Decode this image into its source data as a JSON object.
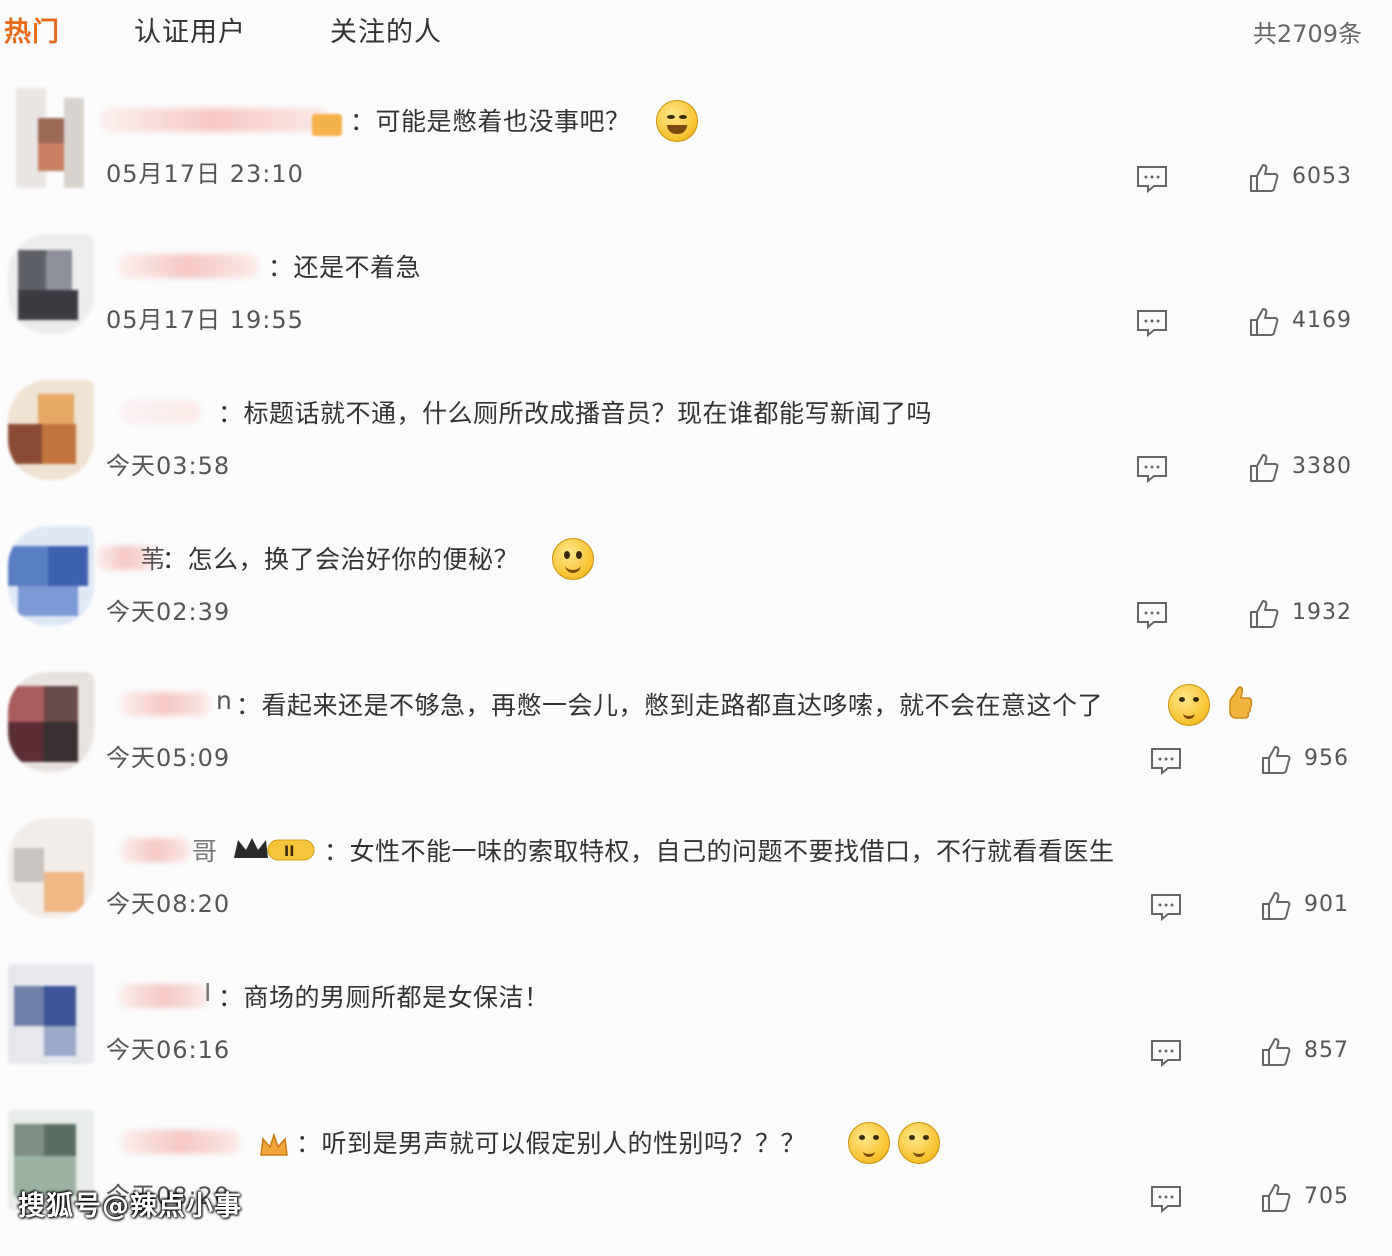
{
  "tabs": [
    {
      "label": "热门",
      "active": true
    },
    {
      "label": "认证用户",
      "active": false
    },
    {
      "label": "关注的人",
      "active": false
    }
  ],
  "total_count": "共2709条",
  "accent_color": "#e86a1a",
  "comments": [
    {
      "name_fragment": "",
      "text": "：可能是憋着也没事吧？",
      "time": "05月17日 23:10",
      "likes": "6053",
      "emojis": [
        "laugh-cry-emoji"
      ]
    },
    {
      "name_fragment": "",
      "text": "：还是不着急",
      "time": "05月17日 19:55",
      "likes": "4169",
      "emojis": []
    },
    {
      "name_fragment": "",
      "text": "：标题话就不通，什么厕所改成播音员？现在谁都能写新闻了吗",
      "time": "今天03:58",
      "likes": "3380",
      "emojis": []
    },
    {
      "name_fragment": "苇",
      "text": "：怎么，换了会治好你的便秘？",
      "time": "今天02:39",
      "likes": "1932",
      "emojis": [
        "smile-emoji"
      ]
    },
    {
      "name_fragment": "n",
      "text": "：看起来还是不够急，再憋一会儿，憋到走路都直达哆嗦，就不会在意这个了",
      "time": "今天05:09",
      "likes": "956",
      "emojis": [
        "doge-emoji",
        "thumbs-up-emoji"
      ]
    },
    {
      "name_fragment": "哥",
      "text": "：女性不能一味的索取特权，自己的问题不要找借口，不行就看看医生",
      "time": "今天08:20",
      "likes": "901",
      "emojis": []
    },
    {
      "name_fragment": "I",
      "text": "：商场的男厕所都是女保洁！",
      "time": "今天06:16",
      "likes": "857",
      "emojis": []
    },
    {
      "name_fragment": "",
      "text": "：听到是男声就可以假定别人的性别吗？？？",
      "time": "今天08:20",
      "likes": "705",
      "emojis": [
        "doge-emoji",
        "doge-emoji"
      ]
    }
  ],
  "watermark": "搜狐号@辣点小事"
}
